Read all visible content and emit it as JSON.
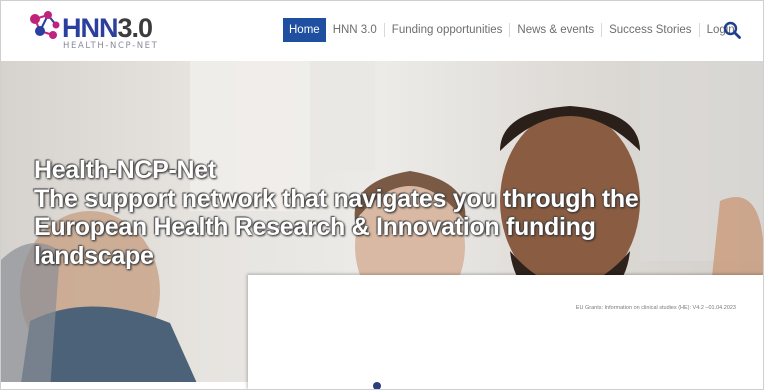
{
  "logo": {
    "name_main": "HNN",
    "name_version": "3.0",
    "subtitle": "HEALTH-NCP-NET",
    "colors": {
      "blue": "#2a3f9e",
      "magenta": "#c0247a",
      "grey": "#3c3c3c"
    }
  },
  "nav": {
    "items": [
      {
        "label": "Home",
        "active": true
      },
      {
        "label": "HNN 3.0",
        "active": false
      },
      {
        "label": "Funding opportunities",
        "active": false
      },
      {
        "label": "News & events",
        "active": false
      },
      {
        "label": "Success Stories",
        "active": false
      },
      {
        "label": "Login",
        "active": false
      }
    ],
    "search_icon": "search-icon",
    "active_color": "#1f4fa0"
  },
  "hero": {
    "line1": "Health-NCP-Net",
    "line2": "The support network that navigates you through the",
    "line3": "European Health Research & Innovation funding",
    "line4": "landscape"
  },
  "doc_overlay": {
    "caption": "EU Grants: Information on clinical studies (HE): V4.2 –01.04.2023"
  }
}
